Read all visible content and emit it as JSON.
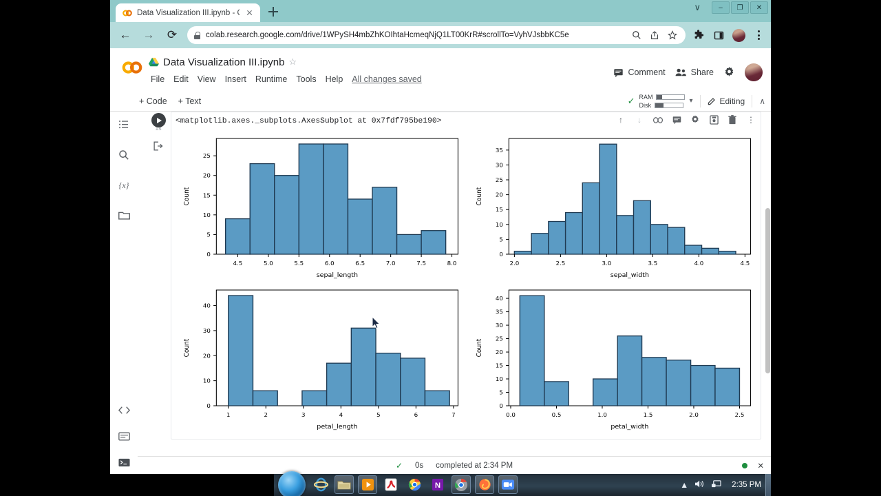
{
  "browser": {
    "tab": {
      "title": "Data Visualization III.ipynb - Cola",
      "favicon": "colab-icon",
      "close": "close-icon"
    },
    "new_tab": "new-tab-icon",
    "window_controls": {
      "minimize": "–",
      "maximize": "❐",
      "close": "✕",
      "chevron": "∨"
    },
    "nav": {
      "back": "←",
      "forward": "→",
      "reload": "⟳"
    },
    "url": "colab.research.google.com/drive/1WPySH4mbZhKOIhtaHcmeqNjQ1LT00KrR#scrollTo=VyhVJsbbKC5e",
    "url_host": "colab.research.google.com",
    "url_path": "/drive/1WPySH4mbZhKOIhtaHcmeqNjQ1LT00KrR#scrollTo=VyhVJsbbKC5e",
    "omni_icons": [
      "search-icon",
      "share-icon",
      "bookmark-star-icon"
    ],
    "toolbar_icons": [
      "extensions-puzzle-icon",
      "side-panel-icon",
      "profile-avatar",
      "chrome-menu-kebab"
    ]
  },
  "colab": {
    "logo": "colab-logo",
    "notebook_title": "Data Visualization III.ipynb",
    "drive_icon": "drive-icon",
    "star_icon": "☆",
    "menu": [
      "File",
      "Edit",
      "View",
      "Insert",
      "Runtime",
      "Tools",
      "Help"
    ],
    "save_status": "All changes saved",
    "header_actions": {
      "comment": "Comment",
      "share": "Share",
      "settings": "gear-icon",
      "account": "account-avatar"
    },
    "toolbar": {
      "add_code": "+ Code",
      "add_text": "+ Text",
      "ram": "RAM",
      "disk": "Disk",
      "editing": "Editing",
      "connected_check": "✓",
      "dropdown": "▾",
      "collapse": "∧",
      "ram_fill_pct": 18,
      "disk_fill_pct": 30
    },
    "rail_icons": [
      "table-of-contents-icon",
      "search-icon",
      "variables-icon",
      "files-folder-icon"
    ],
    "rail_bottom_icons": [
      "code-snippets-icon",
      "command-palette-icon",
      "terminal-icon"
    ],
    "cell": {
      "status_check": "✓",
      "exec_time": "1s",
      "run_button": "run-cell-icon",
      "output_link_icon": "open-output-icon",
      "output_text": "<matplotlib.axes._subplots.AxesSubplot at 0x7fdf795be190>",
      "tools": [
        "move-cell-up-icon",
        "move-cell-down-icon",
        "link-to-cell-icon",
        "add-comment-icon",
        "cell-settings-icon",
        "mirror-cell-icon",
        "delete-cell-icon",
        "more-options-kebab"
      ]
    },
    "exec_bar": {
      "check": "✓",
      "duration": "0s",
      "message": "completed at 2:34 PM",
      "status_dot": "#1e8e3e",
      "close": "✕"
    }
  },
  "chart_data": [
    {
      "type": "bar",
      "title": "",
      "xlabel": "sepal_length",
      "ylabel": "Count",
      "xlim": [
        4.15,
        8.1
      ],
      "ylim": [
        0,
        29.4
      ],
      "xticks": [
        "4.5",
        "5.0",
        "5.5",
        "6.0",
        "6.5",
        "7.0",
        "7.5",
        "8.0"
      ],
      "xtick_values": [
        4.5,
        5.0,
        5.5,
        6.0,
        6.5,
        7.0,
        7.5,
        8.0
      ],
      "yticks": [
        "0",
        "5",
        "10",
        "15",
        "20",
        "25"
      ],
      "ytick_values": [
        0,
        5,
        10,
        15,
        20,
        25
      ],
      "bin_edges": [
        4.3,
        4.7,
        5.1,
        5.5,
        5.9,
        6.3,
        6.7,
        7.1,
        7.5,
        7.9
      ],
      "values": [
        9,
        23,
        20,
        28,
        28,
        14,
        17,
        5,
        6
      ],
      "grid": false,
      "bar_color": "#5B9BC4",
      "bar_edge_color": "#1f3a52"
    },
    {
      "type": "bar",
      "title": "",
      "xlabel": "sepal_width",
      "ylabel": "Count",
      "xlim": [
        1.94,
        4.56
      ],
      "ylim": [
        0,
        38.9
      ],
      "xticks": [
        "2.0",
        "2.5",
        "3.0",
        "3.5",
        "4.0",
        "4.5"
      ],
      "xtick_values": [
        2.0,
        2.5,
        3.0,
        3.5,
        4.0,
        4.5
      ],
      "yticks": [
        "0",
        "5",
        "10",
        "15",
        "20",
        "25",
        "30",
        "35"
      ],
      "ytick_values": [
        0,
        5,
        10,
        15,
        20,
        25,
        30,
        35
      ],
      "bin_edges": [
        2.0,
        2.185,
        2.369,
        2.554,
        2.738,
        2.923,
        3.108,
        3.292,
        3.477,
        3.662,
        3.846,
        4.031,
        4.215,
        4.4
      ],
      "values": [
        1,
        7,
        11,
        14,
        24,
        37,
        13,
        18,
        10,
        9,
        3,
        2,
        1
      ],
      "grid": false,
      "bar_color": "#5B9BC4",
      "bar_edge_color": "#1f3a52"
    },
    {
      "type": "bar",
      "title": "",
      "xlabel": "petal_length",
      "ylabel": "Count",
      "xlim": [
        0.68,
        7.12
      ],
      "ylim": [
        0,
        46.2
      ],
      "xticks": [
        "1",
        "2",
        "3",
        "4",
        "5",
        "6",
        "7"
      ],
      "xtick_values": [
        1,
        2,
        3,
        4,
        5,
        6,
        7
      ],
      "yticks": [
        "0",
        "10",
        "20",
        "30",
        "40"
      ],
      "ytick_values": [
        0,
        10,
        20,
        30,
        40
      ],
      "bin_edges": [
        1.0,
        1.655,
        2.31,
        2.965,
        3.62,
        4.275,
        4.93,
        5.585,
        6.24,
        6.895
      ],
      "values": [
        44,
        6,
        0,
        6,
        17,
        31,
        21,
        19,
        6
      ],
      "grid": false,
      "bar_color": "#5B9BC4",
      "bar_edge_color": "#1f3a52"
    },
    {
      "type": "bar",
      "title": "",
      "xlabel": "petal_width",
      "ylabel": "Count",
      "xlim": [
        -0.02,
        2.62
      ],
      "ylim": [
        0,
        43.1
      ],
      "xticks": [
        "0.0",
        "0.5",
        "1.0",
        "1.5",
        "2.0",
        "2.5"
      ],
      "xtick_values": [
        0.0,
        0.5,
        1.0,
        1.5,
        2.0,
        2.5
      ],
      "yticks": [
        "0",
        "5",
        "10",
        "15",
        "20",
        "25",
        "30",
        "35",
        "40"
      ],
      "ytick_values": [
        0,
        5,
        10,
        15,
        20,
        25,
        30,
        35,
        40
      ],
      "bin_edges": [
        0.1,
        0.367,
        0.633,
        0.9,
        1.167,
        1.433,
        1.7,
        1.967,
        2.233,
        2.5
      ],
      "values": [
        41,
        9,
        0,
        10,
        26,
        18,
        17,
        15,
        14
      ],
      "grid": false,
      "bar_color": "#5B9BC4",
      "bar_edge_color": "#1f3a52"
    }
  ],
  "taskbar": {
    "start": "windows-start-orb",
    "items": [
      "internet-explorer-icon",
      "file-explorer-icon",
      "media-player-icon",
      "adobe-reader-icon",
      "chrome-icon",
      "onenote-icon",
      "chrome-active-icon",
      "firefox-icon",
      "zoom-icon"
    ],
    "tray": {
      "expand": "▲",
      "volume": "volume-icon",
      "network": "network-icon"
    },
    "clock": "2:35 PM"
  }
}
